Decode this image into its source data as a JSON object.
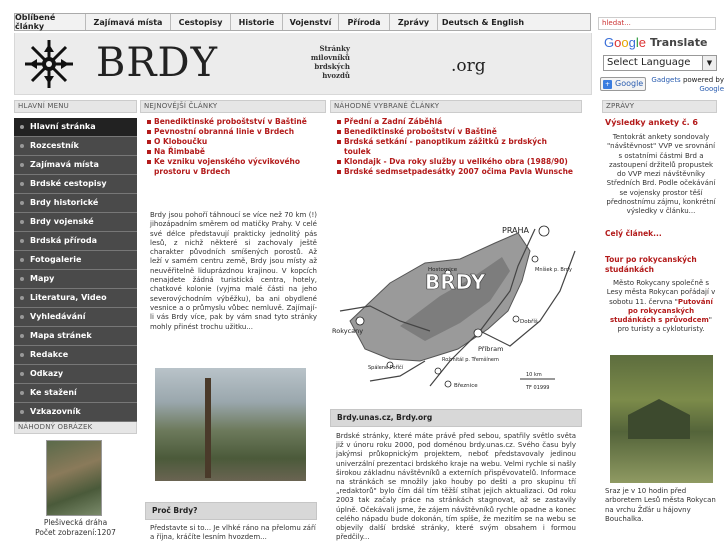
{
  "nav": {
    "items": [
      {
        "label": "Oblíbené články",
        "w": 71
      },
      {
        "label": "Zajímavá místa",
        "w": 85
      },
      {
        "label": "Cestopisy",
        "w": 60
      },
      {
        "label": "Historie",
        "w": 52
      },
      {
        "label": "Vojenství",
        "w": 56
      },
      {
        "label": "Příroda",
        "w": 51
      },
      {
        "label": "Zprávy",
        "w": 48
      },
      {
        "label": "Deutsch & English",
        "w": 90
      }
    ],
    "search_placeholder": "hledat..."
  },
  "header": {
    "logo_text": "BRDY",
    "tagline": [
      "Stránky",
      "milovníků",
      "brdských",
      "hvozdů"
    ],
    "tld": ".org"
  },
  "translate": {
    "logo": "Google",
    "label": "Translate",
    "select_value": "Select Language",
    "badge": "Google",
    "powered": "Gadgets",
    "powered_by": "powered by",
    "powered_google": "Google"
  },
  "sections": {
    "main_menu": "HLAVNÍ MENU",
    "newest": "NEJNOVĚJŠÍ ČLÁNKY",
    "random_selected": "NÁHODNĚ VYBRANÉ ČLÁNKY",
    "news": "ZPRÁVY",
    "random_image": "NÁHODNÝ OBRÁZEK"
  },
  "menu": [
    "Hlavní stránka",
    "Rozcestník",
    "Zajímavá místa",
    "Brdské cestopisy",
    "Brdy historické",
    "Brdy vojenské",
    "Brdská příroda",
    "Fotogalerie",
    "Mapy",
    "Literatura, Video",
    "Vyhledávání",
    "Mapa stránek",
    "Redakce",
    "Odkazy",
    "Ke stažení",
    "Vzkazovník"
  ],
  "newest_articles": [
    "Benediktinské proboštství v Baštině",
    "Pevnostní obranná linie v Brdech",
    "O Kloboučku",
    "Na Řimbabě",
    "Ke vzniku vojenského výcvikového prostoru v Brdech"
  ],
  "random_articles": [
    "Přední a Zadní Záběhlá",
    "Benediktinské proboštství v Baštině",
    "Brdská setkání - panoptikum zážitků z brdských toulek",
    "Klondajk - Dva roky služby u velikého obra (1988/90)",
    "Brdské sedmsetpadesátky 2007 očima Pavla Wunsche"
  ],
  "random_image": {
    "caption": "Plešivecká dráha",
    "views": "Počet zobrazení:1207"
  },
  "intro": "Brdy jsou pohoří táhnoucí se více než 70 km (!) jihozápadním směrem od matičky Prahy. V celé své délce představují prakticky jednolitý pás lesů, z nichž některé si zachovaly ještě charakter původních smíšených porostů. Až leží v samém centru země, Brdy jsou místy až neuvěřitelně liduprázdnou krajinou. V kopcích nenajdete žádná turistická centra, hotely, chatkové kolonie (vyjma malé části na jeho severovýchodním výběžku), ba ani obydlené vesnice a o průmyslu vůbec nemluvě. Zajímají-li vás Brdy více, pak by vám snad tyto stránky mohly přinést trochu užitku...",
  "map": {
    "praha": "PRAHA",
    "brdy": "BRDY",
    "rokycany": "Rokycany",
    "pribram": "Příbram",
    "spalene_porici": "Spálené Poříčí",
    "roz_tremosne": "Rožmitál p. Třemšínem",
    "breznice": "Březnice",
    "dobris": "Dobříš",
    "hostomice": "Hostomice",
    "mnisek": "Mníšek p. Brdy",
    "scale": "10 km",
    "year": "TF 01999"
  },
  "brdy_box": {
    "title": "Brdy.unas.cz, Brdy.org",
    "text": "Brdské stránky, které máte právě před sebou, spatřily světlo světa již v únoru roku 2000, pod doménou brdy.unas.cz. Svého času byly jakýmsi průkopnickým projektem, neboť představovaly jedinou univerzální prezentaci brdského kraje na webu. Velmi rychle si našly širokou základnu návštěvníků a externích přispěvovatelů. Informace na stránkách se množily jako houby po dešti a pro skupinu tří „redaktorů\" bylo čím dál tím těžší stíhat jejich aktualizaci. Od roku 2003 tak začaly práce na stránkách stagnovat, až se zastavily úplně. Očekávali jsme, že zájem návštěvníků rychle opadne a konec celého nápadu bude dokonán, tím spíše, že mezitím se na webu se objevily další brdské stránky, které svým obsahem i formou předčily..."
  },
  "proc_box": {
    "title": "Proč Brdy?",
    "text": "Představte si to... Je vlhké ráno na přelomu září a října, kráčíte lesním hvozdem..."
  },
  "news": {
    "title1": "Výsledky ankety č. 6",
    "body1": "Tentokrát ankety sondovaly \"návštěvnost\" VVP ve srovnání s ostatními částmi Brd a zastoupení držitelů propustek do VVP mezi návštěvníky Středních Brd. Podle očekávání se vojensky prostor těší přednostnímu zájmu, konkrétní výsledky v článku...",
    "more": "Celý článek...",
    "title2": "Tour po rokycanských studánkách",
    "body2_a": "Město Rokycany společně s Lesy města Rokycan pořádají v sobotu 11. června \"",
    "body2_em": "Putování po rokycanských studánkách s průvodcem",
    "body2_b": "\" pro turisty a cykloturisty.",
    "caption": "Sraz je v 10 hodin před arboretem Lesů města Rokycan na vrchu Žďár u hájovny Bouchalka."
  }
}
